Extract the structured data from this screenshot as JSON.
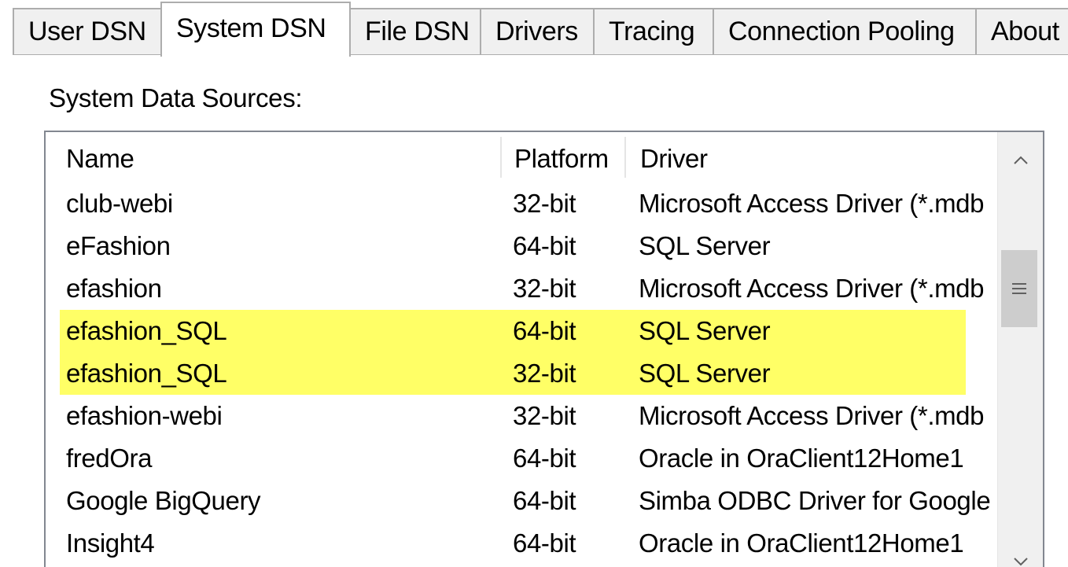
{
  "tabs": [
    {
      "label": "User DSN"
    },
    {
      "label": "System DSN"
    },
    {
      "label": "File DSN"
    },
    {
      "label": "Drivers"
    },
    {
      "label": "Tracing"
    },
    {
      "label": "Connection Pooling"
    },
    {
      "label": "About"
    }
  ],
  "active_tab": "System DSN",
  "section_label": "System Data Sources:",
  "list": {
    "columns": [
      "Name",
      "Platform",
      "Driver"
    ],
    "rows": [
      {
        "name": "club-webi",
        "platform": "32-bit",
        "driver": "Microsoft Access Driver (*.mdb"
      },
      {
        "name": "eFashion",
        "platform": "64-bit",
        "driver": "SQL Server"
      },
      {
        "name": "efashion",
        "platform": "32-bit",
        "driver": "Microsoft Access Driver (*.mdb"
      },
      {
        "name": "efashion_SQL",
        "platform": "64-bit",
        "driver": "SQL Server"
      },
      {
        "name": "efashion_SQL",
        "platform": "32-bit",
        "driver": "SQL Server"
      },
      {
        "name": "efashion-webi",
        "platform": "32-bit",
        "driver": "Microsoft Access Driver (*.mdb"
      },
      {
        "name": "fredOra",
        "platform": "64-bit",
        "driver": "Oracle in OraClient12Home1"
      },
      {
        "name": "Google BigQuery",
        "platform": "64-bit",
        "driver": "Simba ODBC Driver for Google"
      },
      {
        "name": "Insight4",
        "platform": "64-bit",
        "driver": "Oracle in OraClient12Home1"
      }
    ],
    "highlighted_rows": [
      3,
      4
    ],
    "highlight_color": "#ffff66"
  },
  "scrollbar": {
    "up_icon": "chevron-up-icon",
    "down_icon": "chevron-down-icon",
    "grip_icon": "grip-icon"
  }
}
